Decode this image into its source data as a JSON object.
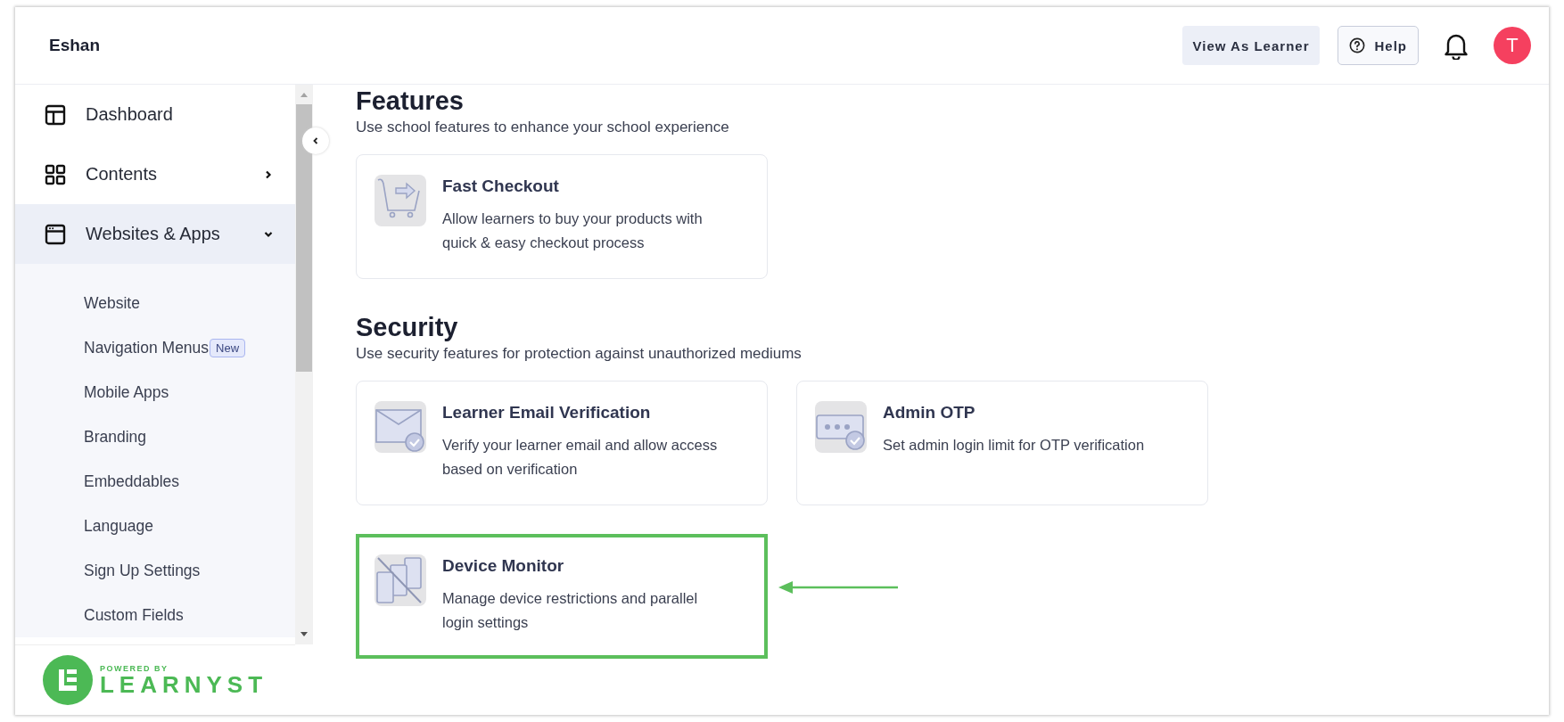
{
  "header": {
    "brand": "Eshan",
    "view_as_learner": "View As Learner",
    "help": "Help",
    "avatar": "T"
  },
  "sidebar": {
    "items": [
      {
        "label": "Dashboard",
        "selected": false
      },
      {
        "label": "Contents",
        "selected": false,
        "expanded": false
      },
      {
        "label": "Websites & Apps",
        "selected": true,
        "expanded": true,
        "children": [
          {
            "label": "Website"
          },
          {
            "label": "Navigation Menus",
            "badge": "New"
          },
          {
            "label": "Mobile Apps"
          },
          {
            "label": "Branding"
          },
          {
            "label": "Embeddables"
          },
          {
            "label": "Language"
          },
          {
            "label": "Sign Up Settings"
          },
          {
            "label": "Custom Fields"
          }
        ]
      }
    ],
    "footer": {
      "powered_by": "POWERED BY",
      "brand": "LEARNYST"
    }
  },
  "sections": [
    {
      "title": "Features",
      "description": "Use school features to enhance your school experience",
      "cards": [
        {
          "title": "Fast Checkout",
          "description": "Allow learners to buy your products with quick & easy checkout process",
          "highlighted": false
        }
      ]
    },
    {
      "title": "Security",
      "description": "Use security features for protection against unauthorized mediums",
      "cards": [
        {
          "title": "Learner Email Verification",
          "description": "Verify your learner email and allow access based on verification",
          "highlighted": false
        },
        {
          "title": "Admin OTP",
          "description": "Set admin login limit for OTP verification",
          "highlighted": false
        },
        {
          "title": "Device Monitor",
          "description": "Manage device restrictions and parallel login settings",
          "highlighted": true
        }
      ]
    }
  ]
}
